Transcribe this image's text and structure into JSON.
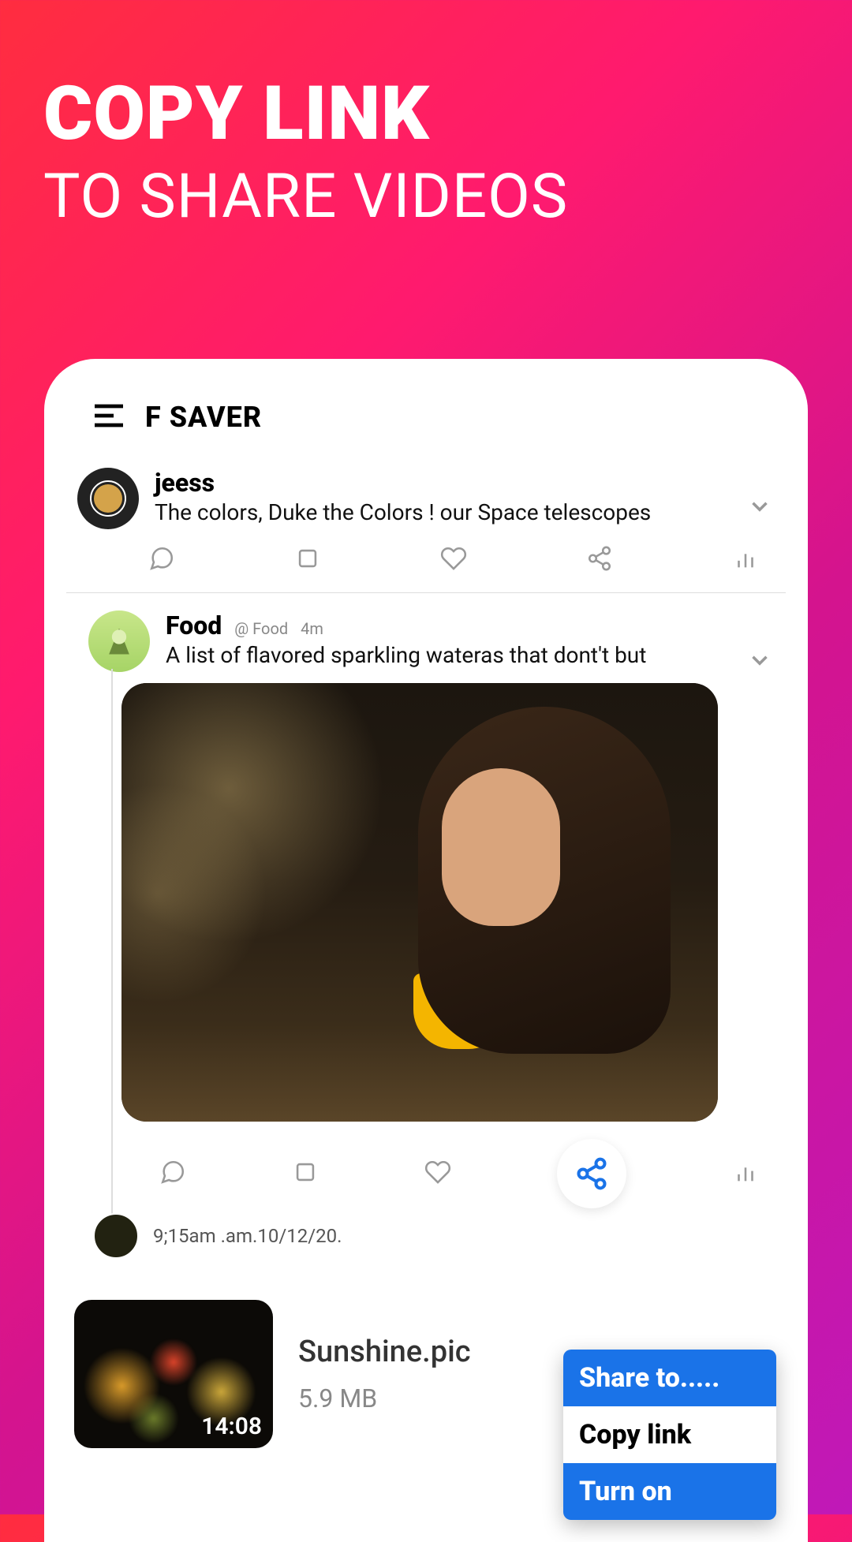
{
  "hero": {
    "line1": "COPY LINK",
    "line2": "TO SHARE VIDEOS"
  },
  "app": {
    "title": "F SAVER"
  },
  "post1": {
    "username": "jeess",
    "text": "The colors, Duke the Colors ! our Space  telescopes"
  },
  "post2": {
    "username": "Food",
    "handle": "@ Food",
    "time": "4m",
    "text": "A list of flavored sparkling wateras that dont't but",
    "timestamp": "9;15am .am.10/12/20."
  },
  "download": {
    "filename": "Sunshine.pic",
    "filesize": "5.9 MB",
    "duration": "14:08"
  },
  "share_menu": {
    "item1": "Share to.....",
    "item2": "Copy link",
    "item3": "Turn on"
  }
}
